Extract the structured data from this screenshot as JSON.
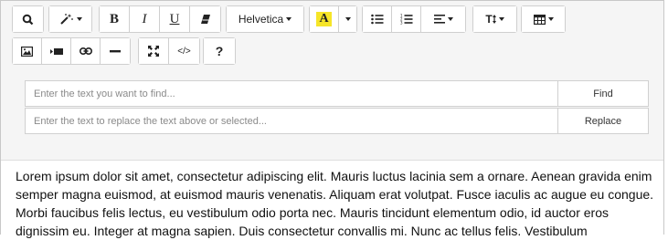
{
  "toolbar": {
    "font_name": "Helvetica",
    "highlight_letter": "A",
    "highlight_color": "#f6e528",
    "bold_label": "B",
    "italic_label": "I",
    "underline_label": "U",
    "text_size_label": "T",
    "code_label": "</>",
    "help_label": "?",
    "icons": [
      "search-icon",
      "magic-wand-icon",
      "bold-icon",
      "italic-icon",
      "underline-icon",
      "eraser-icon",
      "font-family-dropdown",
      "highlight-icon",
      "bullet-list-icon",
      "numbered-list-icon",
      "align-icon",
      "text-size-icon",
      "table-icon",
      "image-icon",
      "video-icon",
      "link-icon",
      "horizontal-rule-icon",
      "fullscreen-icon",
      "code-view-icon",
      "help-icon"
    ]
  },
  "find_replace": {
    "find_placeholder": "Enter the text you want to find...",
    "replace_placeholder": "Enter the text to replace the text above or selected...",
    "find_label": "Find",
    "replace_label": "Replace"
  },
  "content": {
    "text": "Lorem ipsum dolor sit amet, consectetur adipiscing elit. Mauris luctus lacinia sem a ornare. Aenean gravida enim semper magna euismod, at euismod mauris venenatis. Aliquam erat volutpat. Fusce iaculis ac augue eu congue. Morbi faucibus felis lectus, eu vestibulum odio porta nec. Mauris tincidunt elementum odio, id auctor eros dignissim eu. Integer at magna sapien. Duis consectetur convallis mi. Nunc ac tellus felis. Vestibulum"
  }
}
